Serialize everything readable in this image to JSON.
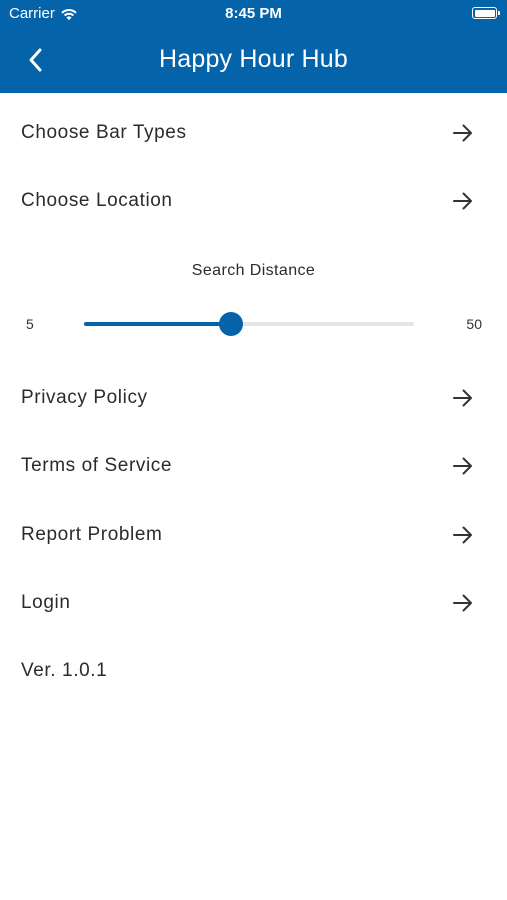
{
  "status_bar": {
    "carrier": "Carrier",
    "time": "8:45 PM",
    "battery_level": 1.0
  },
  "nav": {
    "title": "Happy Hour Hub",
    "back_icon": "chevron-left-icon"
  },
  "menu": {
    "bar_types": "Choose Bar Types",
    "location": "Choose Location",
    "privacy": "Privacy Policy",
    "terms": "Terms of Service",
    "report": "Report Problem",
    "login": "Login",
    "arrow_icon": "arrow-right-icon"
  },
  "distance": {
    "title": "Search Distance",
    "min": "5",
    "max": "50",
    "value": 25
  },
  "version": "Ver. 1.0.1",
  "colors": {
    "brand": "#0563a9",
    "track": "#e4e6ec",
    "text": "#2b2b2b"
  }
}
